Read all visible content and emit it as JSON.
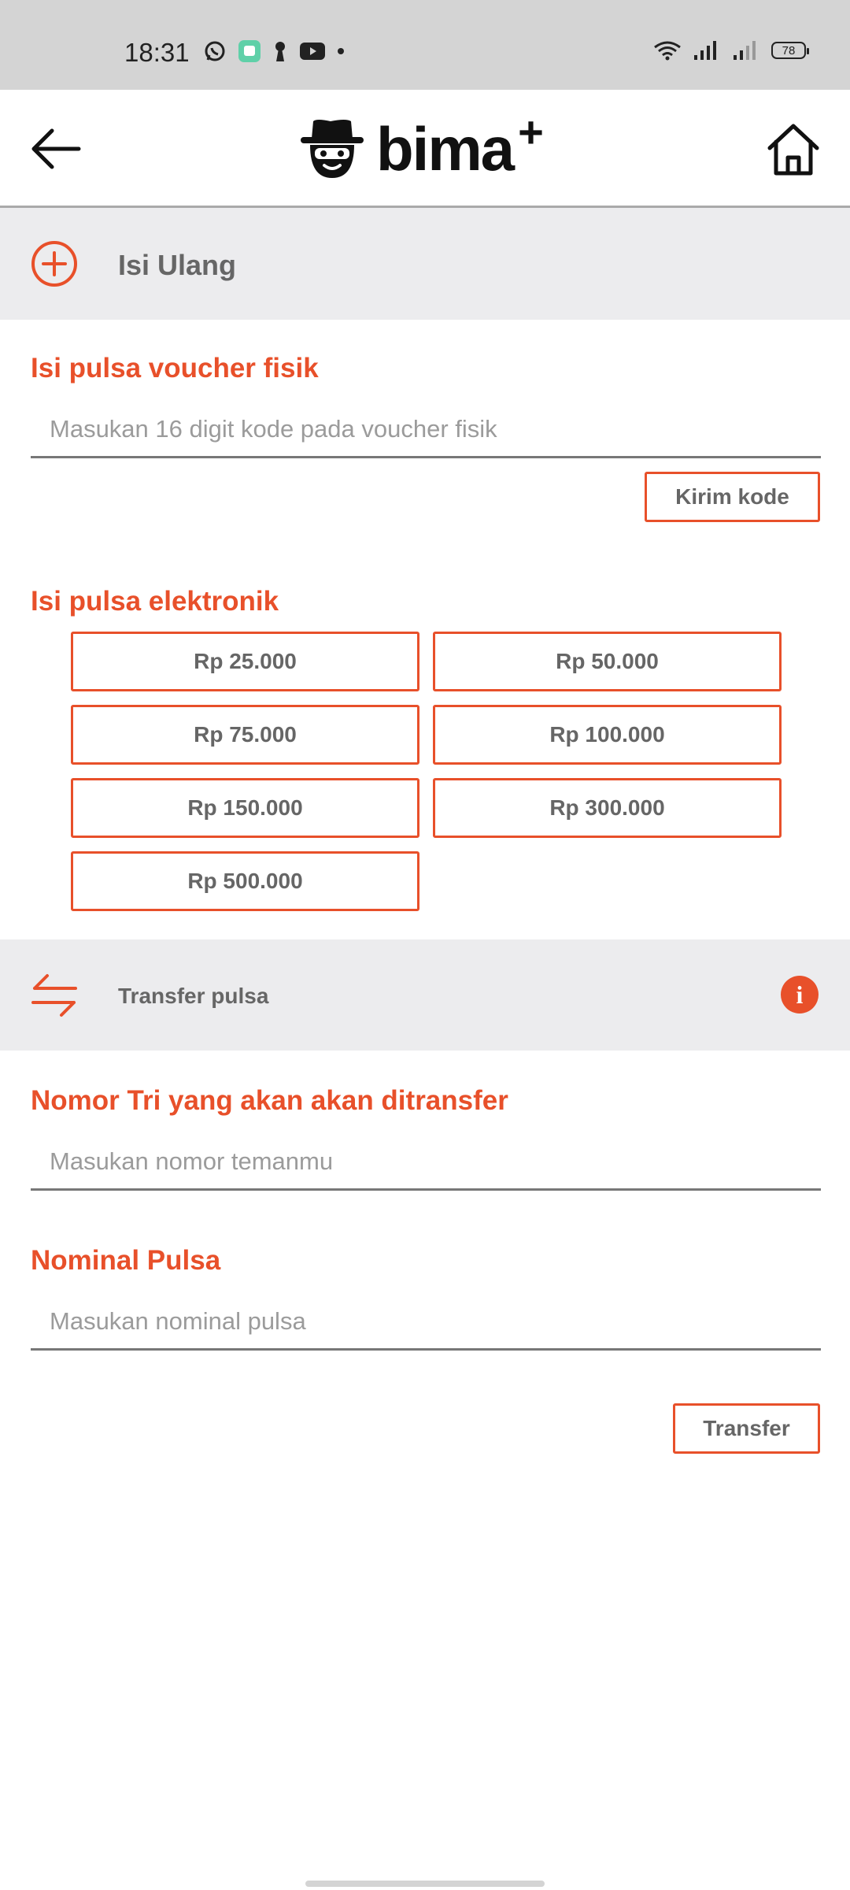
{
  "status_bar": {
    "time": "18:31",
    "battery": "78",
    "left_icons": [
      "whatsapp-icon",
      "chat-app-icon",
      "keyhole-icon",
      "youtube-icon",
      "dot-icon"
    ],
    "right_icons": [
      "wifi-icon",
      "signal-icon",
      "signal-icon"
    ]
  },
  "header": {
    "logo_text": "bima",
    "logo_plus": "+"
  },
  "isi_ulang": {
    "title": "Isi Ulang"
  },
  "voucher": {
    "heading": "Isi pulsa voucher fisik",
    "placeholder": "Masukan 16 digit kode pada voucher fisik",
    "value": "",
    "button_label": "Kirim kode"
  },
  "elektronik": {
    "heading": "Isi pulsa elektronik",
    "options": [
      "Rp 25.000",
      "Rp 50.000",
      "Rp 75.000",
      "Rp 100.000",
      "Rp 150.000",
      "Rp 300.000",
      "Rp 500.000"
    ]
  },
  "transfer": {
    "title": "Transfer pulsa",
    "number_heading": "Nomor Tri yang akan akan ditransfer",
    "number_placeholder": "Masukan nomor temanmu",
    "nominal_heading": "Nominal Pulsa",
    "nominal_placeholder": "Masukan nominal pulsa",
    "button_label": "Transfer",
    "info_glyph": "i"
  },
  "colors": {
    "accent": "#e8502a",
    "band": "#ececee",
    "status_bar": "#d4d4d4"
  }
}
